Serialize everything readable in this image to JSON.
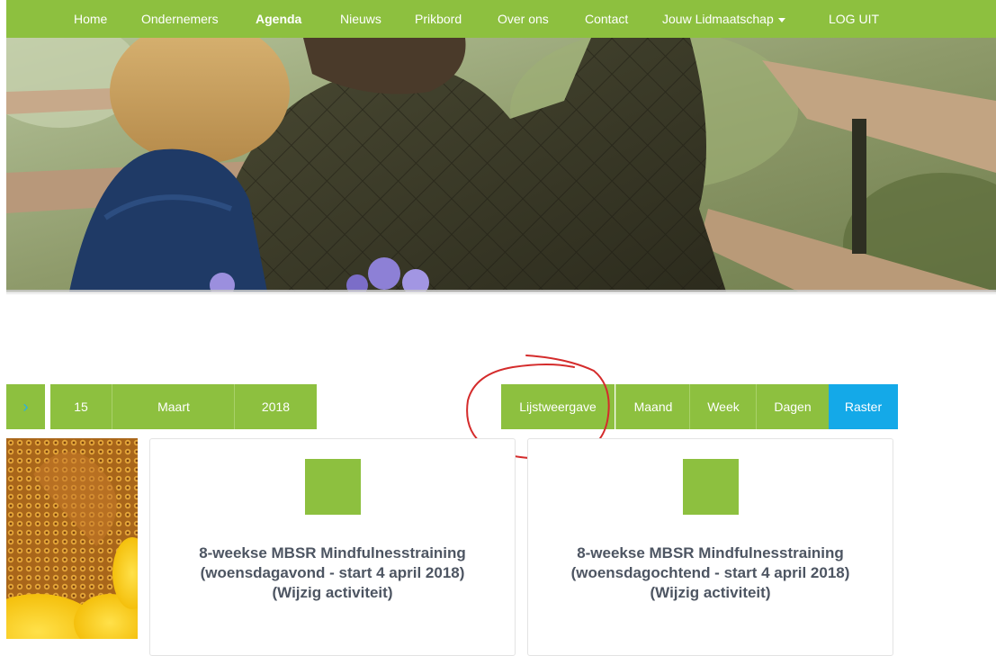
{
  "nav": {
    "items": [
      {
        "label": "Home"
      },
      {
        "label": "Ondernemers"
      },
      {
        "label": "Agenda"
      },
      {
        "label": "Nieuws"
      },
      {
        "label": "Prikbord"
      },
      {
        "label": "Over ons"
      },
      {
        "label": "Contact"
      },
      {
        "label": "Jouw Lidmaatschap"
      },
      {
        "label": "LOG UIT"
      }
    ]
  },
  "calendar": {
    "day": "15",
    "month": "Maart",
    "year": "2018",
    "views": {
      "list": "Lijstweergave",
      "month": "Maand",
      "week": "Week",
      "days": "Dagen",
      "grid": "Raster"
    }
  },
  "events": [
    {
      "title_line1": "8-weekse MBSR Mindfulnesstraining",
      "title_line2": "(woensdagavond - start 4 april 2018)",
      "edit_label": "(Wijzig activiteit)"
    },
    {
      "title_line1": "8-weekse MBSR Mindfulnesstraining",
      "title_line2": "(woensdagochtend - start 4 april 2018)",
      "edit_label": "(Wijzig activiteit)"
    }
  ],
  "colors": {
    "accent_green": "#8dc03f",
    "accent_blue": "#14a9e8",
    "annotation_red": "#d42b2b"
  }
}
